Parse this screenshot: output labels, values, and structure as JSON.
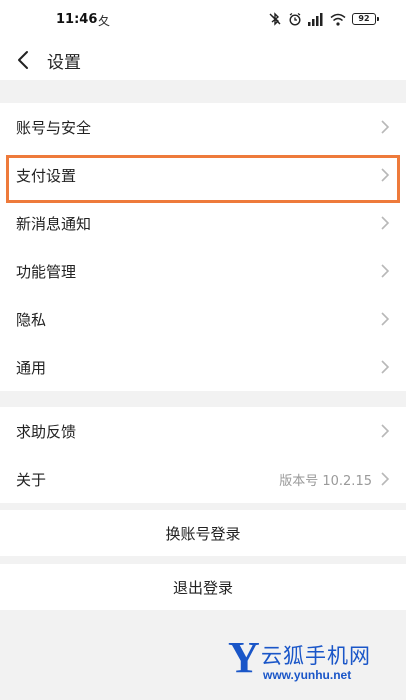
{
  "status_bar": {
    "time": "11:46",
    "notification": "夂",
    "battery": "92",
    "icons": [
      "bluetooth-off-icon",
      "alarm-icon",
      "signal-icon",
      "wifi-icon",
      "battery-icon"
    ]
  },
  "nav": {
    "title": "设置",
    "back_icon": "chevron-left-icon"
  },
  "group1": [
    {
      "label": "账号与安全"
    },
    {
      "label": "支付设置"
    },
    {
      "label": "新消息通知"
    },
    {
      "label": "功能管理"
    },
    {
      "label": "隐私"
    },
    {
      "label": "通用"
    }
  ],
  "group2": [
    {
      "label": "求助反馈"
    },
    {
      "label": "关于",
      "value": "版本号 10.2.15"
    }
  ],
  "buttons": {
    "switch_account": "换账号登录",
    "logout": "退出登录"
  },
  "watermark": {
    "letter": "Y",
    "name": "云狐手机网",
    "url": "www.yunhu.net"
  },
  "colors": {
    "highlight": "#ee7a3b",
    "background": "#f2f2f2",
    "watermark": "#1a56c8"
  }
}
